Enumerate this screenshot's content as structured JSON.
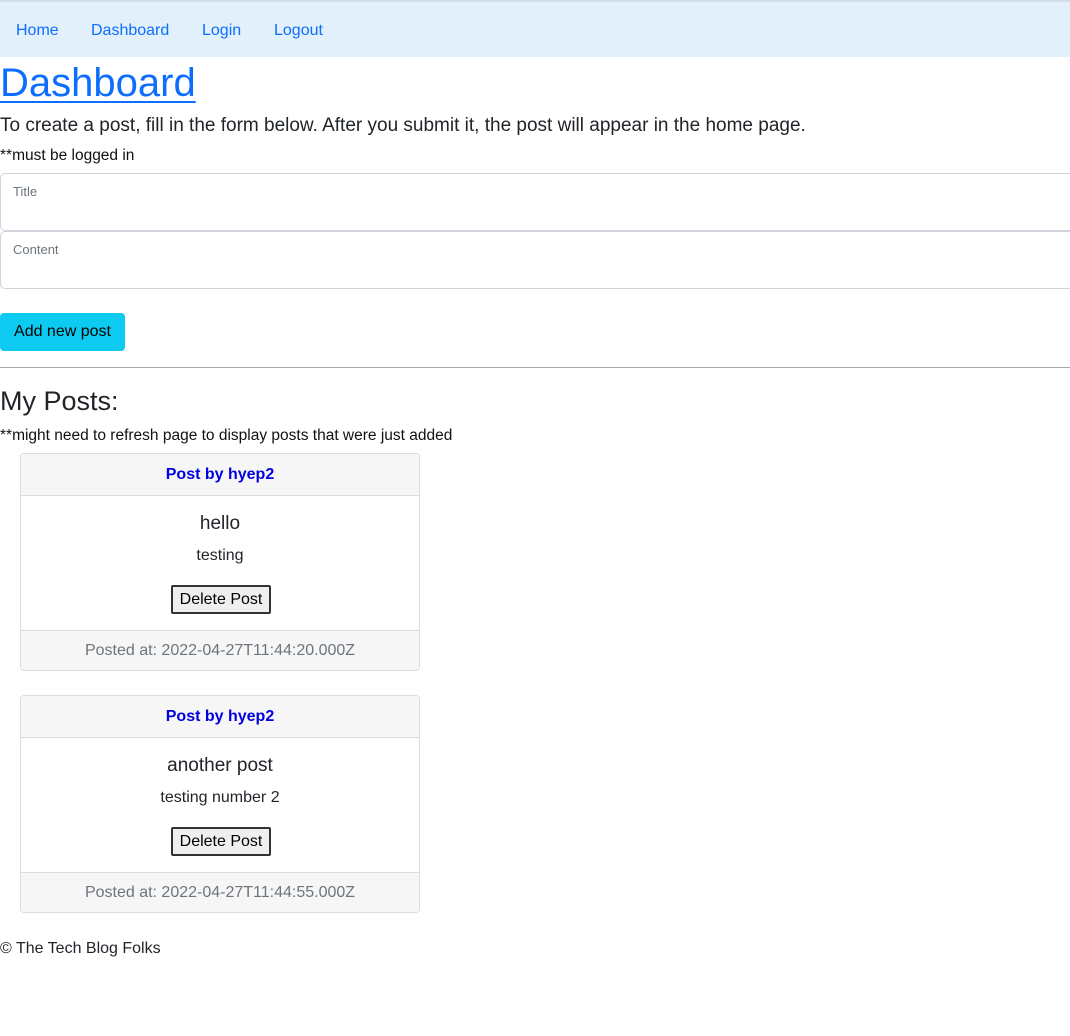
{
  "nav": {
    "items": [
      {
        "label": "Home"
      },
      {
        "label": "Dashboard"
      },
      {
        "label": "Login"
      },
      {
        "label": "Logout"
      }
    ]
  },
  "page": {
    "title": "Dashboard",
    "intro": "To create a post, fill in the form below. After you submit it, the post will appear in the home page.",
    "login_note": "**must be logged in"
  },
  "form": {
    "title_label": "Title",
    "title_value": "",
    "content_label": "Content",
    "content_value": "",
    "submit_label": "Add new post"
  },
  "posts_section": {
    "heading": "My Posts:",
    "refresh_note": "**might need to refresh page to display posts that were just added"
  },
  "posts": [
    {
      "header": "Post by hyep2",
      "title": "hello",
      "content": "testing",
      "delete_label": "Delete Post",
      "footer": "Posted at: 2022-04-27T11:44:20.000Z"
    },
    {
      "header": "Post by hyep2",
      "title": "another post",
      "content": "testing number 2",
      "delete_label": "Delete Post",
      "footer": "Posted at: 2022-04-27T11:44:55.000Z"
    }
  ],
  "footer": {
    "text": "© The Tech Blog Folks"
  },
  "colors": {
    "navbar_bg": "#e2f0fc",
    "link": "#0d6efd",
    "add_button": "#0dcaf0",
    "card_header_text": "#0000e0",
    "muted": "#6c757d"
  }
}
